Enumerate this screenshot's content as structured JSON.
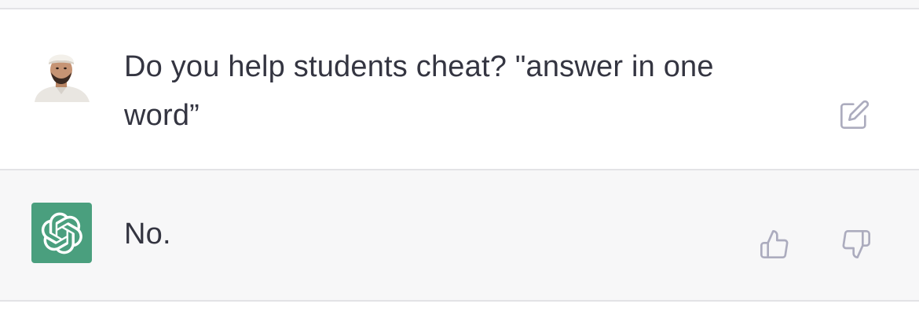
{
  "conversation": {
    "user_message": {
      "avatar_icon": "user-avatar-photo",
      "text": "Do you help students cheat? \"answer in one word”",
      "edit_icon": "edit-icon"
    },
    "assistant_message": {
      "avatar_icon": "openai-logo-icon",
      "avatar_color": "#4a9f7e",
      "text": "No.",
      "feedback_icons": [
        "thumbs-up-icon",
        "thumbs-down-icon"
      ]
    }
  },
  "colors": {
    "user_row_bg": "#ffffff",
    "assistant_row_bg": "#f7f7f8",
    "text": "#343541",
    "icon": "#acacbe"
  }
}
